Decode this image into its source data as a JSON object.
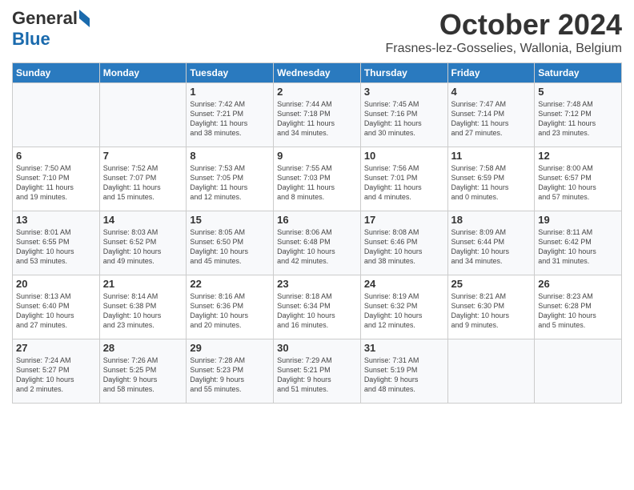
{
  "header": {
    "logo_general": "General",
    "logo_blue": "Blue",
    "month": "October 2024",
    "location": "Frasnes-lez-Gosselies, Wallonia, Belgium"
  },
  "days_of_week": [
    "Sunday",
    "Monday",
    "Tuesday",
    "Wednesday",
    "Thursday",
    "Friday",
    "Saturday"
  ],
  "weeks": [
    [
      {
        "day": "",
        "info": ""
      },
      {
        "day": "",
        "info": ""
      },
      {
        "day": "1",
        "info": "Sunrise: 7:42 AM\nSunset: 7:21 PM\nDaylight: 11 hours\nand 38 minutes."
      },
      {
        "day": "2",
        "info": "Sunrise: 7:44 AM\nSunset: 7:18 PM\nDaylight: 11 hours\nand 34 minutes."
      },
      {
        "day": "3",
        "info": "Sunrise: 7:45 AM\nSunset: 7:16 PM\nDaylight: 11 hours\nand 30 minutes."
      },
      {
        "day": "4",
        "info": "Sunrise: 7:47 AM\nSunset: 7:14 PM\nDaylight: 11 hours\nand 27 minutes."
      },
      {
        "day": "5",
        "info": "Sunrise: 7:48 AM\nSunset: 7:12 PM\nDaylight: 11 hours\nand 23 minutes."
      }
    ],
    [
      {
        "day": "6",
        "info": "Sunrise: 7:50 AM\nSunset: 7:10 PM\nDaylight: 11 hours\nand 19 minutes."
      },
      {
        "day": "7",
        "info": "Sunrise: 7:52 AM\nSunset: 7:07 PM\nDaylight: 11 hours\nand 15 minutes."
      },
      {
        "day": "8",
        "info": "Sunrise: 7:53 AM\nSunset: 7:05 PM\nDaylight: 11 hours\nand 12 minutes."
      },
      {
        "day": "9",
        "info": "Sunrise: 7:55 AM\nSunset: 7:03 PM\nDaylight: 11 hours\nand 8 minutes."
      },
      {
        "day": "10",
        "info": "Sunrise: 7:56 AM\nSunset: 7:01 PM\nDaylight: 11 hours\nand 4 minutes."
      },
      {
        "day": "11",
        "info": "Sunrise: 7:58 AM\nSunset: 6:59 PM\nDaylight: 11 hours\nand 0 minutes."
      },
      {
        "day": "12",
        "info": "Sunrise: 8:00 AM\nSunset: 6:57 PM\nDaylight: 10 hours\nand 57 minutes."
      }
    ],
    [
      {
        "day": "13",
        "info": "Sunrise: 8:01 AM\nSunset: 6:55 PM\nDaylight: 10 hours\nand 53 minutes."
      },
      {
        "day": "14",
        "info": "Sunrise: 8:03 AM\nSunset: 6:52 PM\nDaylight: 10 hours\nand 49 minutes."
      },
      {
        "day": "15",
        "info": "Sunrise: 8:05 AM\nSunset: 6:50 PM\nDaylight: 10 hours\nand 45 minutes."
      },
      {
        "day": "16",
        "info": "Sunrise: 8:06 AM\nSunset: 6:48 PM\nDaylight: 10 hours\nand 42 minutes."
      },
      {
        "day": "17",
        "info": "Sunrise: 8:08 AM\nSunset: 6:46 PM\nDaylight: 10 hours\nand 38 minutes."
      },
      {
        "day": "18",
        "info": "Sunrise: 8:09 AM\nSunset: 6:44 PM\nDaylight: 10 hours\nand 34 minutes."
      },
      {
        "day": "19",
        "info": "Sunrise: 8:11 AM\nSunset: 6:42 PM\nDaylight: 10 hours\nand 31 minutes."
      }
    ],
    [
      {
        "day": "20",
        "info": "Sunrise: 8:13 AM\nSunset: 6:40 PM\nDaylight: 10 hours\nand 27 minutes."
      },
      {
        "day": "21",
        "info": "Sunrise: 8:14 AM\nSunset: 6:38 PM\nDaylight: 10 hours\nand 23 minutes."
      },
      {
        "day": "22",
        "info": "Sunrise: 8:16 AM\nSunset: 6:36 PM\nDaylight: 10 hours\nand 20 minutes."
      },
      {
        "day": "23",
        "info": "Sunrise: 8:18 AM\nSunset: 6:34 PM\nDaylight: 10 hours\nand 16 minutes."
      },
      {
        "day": "24",
        "info": "Sunrise: 8:19 AM\nSunset: 6:32 PM\nDaylight: 10 hours\nand 12 minutes."
      },
      {
        "day": "25",
        "info": "Sunrise: 8:21 AM\nSunset: 6:30 PM\nDaylight: 10 hours\nand 9 minutes."
      },
      {
        "day": "26",
        "info": "Sunrise: 8:23 AM\nSunset: 6:28 PM\nDaylight: 10 hours\nand 5 minutes."
      }
    ],
    [
      {
        "day": "27",
        "info": "Sunrise: 7:24 AM\nSunset: 5:27 PM\nDaylight: 10 hours\nand 2 minutes."
      },
      {
        "day": "28",
        "info": "Sunrise: 7:26 AM\nSunset: 5:25 PM\nDaylight: 9 hours\nand 58 minutes."
      },
      {
        "day": "29",
        "info": "Sunrise: 7:28 AM\nSunset: 5:23 PM\nDaylight: 9 hours\nand 55 minutes."
      },
      {
        "day": "30",
        "info": "Sunrise: 7:29 AM\nSunset: 5:21 PM\nDaylight: 9 hours\nand 51 minutes."
      },
      {
        "day": "31",
        "info": "Sunrise: 7:31 AM\nSunset: 5:19 PM\nDaylight: 9 hours\nand 48 minutes."
      },
      {
        "day": "",
        "info": ""
      },
      {
        "day": "",
        "info": ""
      }
    ]
  ]
}
